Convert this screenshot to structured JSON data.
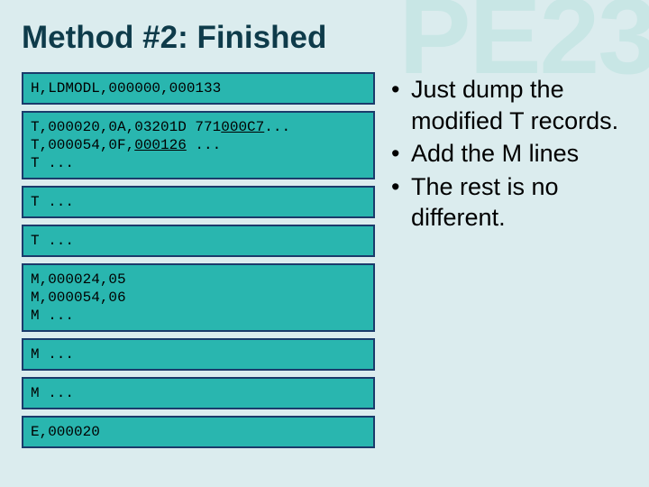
{
  "decor": {
    "text": "PE23"
  },
  "slide": {
    "title": "Method #2: Finished"
  },
  "codeboxes": [
    {
      "lines": [
        "H,LDMODL,000000,000133"
      ]
    },
    {
      "lines": [
        "T,000020,0A,03201D 771<u>000C7</u>...",
        "T,000054,0F,<u>000126</u> ...",
        "T ..."
      ]
    },
    {
      "lines": [
        "T ..."
      ]
    },
    {
      "lines": [
        "T ..."
      ]
    },
    {
      "lines": [
        "M,000024,05",
        "M,000054,06",
        "M ..."
      ]
    },
    {
      "lines": [
        "M ..."
      ]
    },
    {
      "lines": [
        "M ..."
      ]
    },
    {
      "lines": [
        "E,000020"
      ]
    }
  ],
  "bullets": [
    "Just dump the modified T records.",
    "Add the M lines",
    "The rest is no different."
  ]
}
